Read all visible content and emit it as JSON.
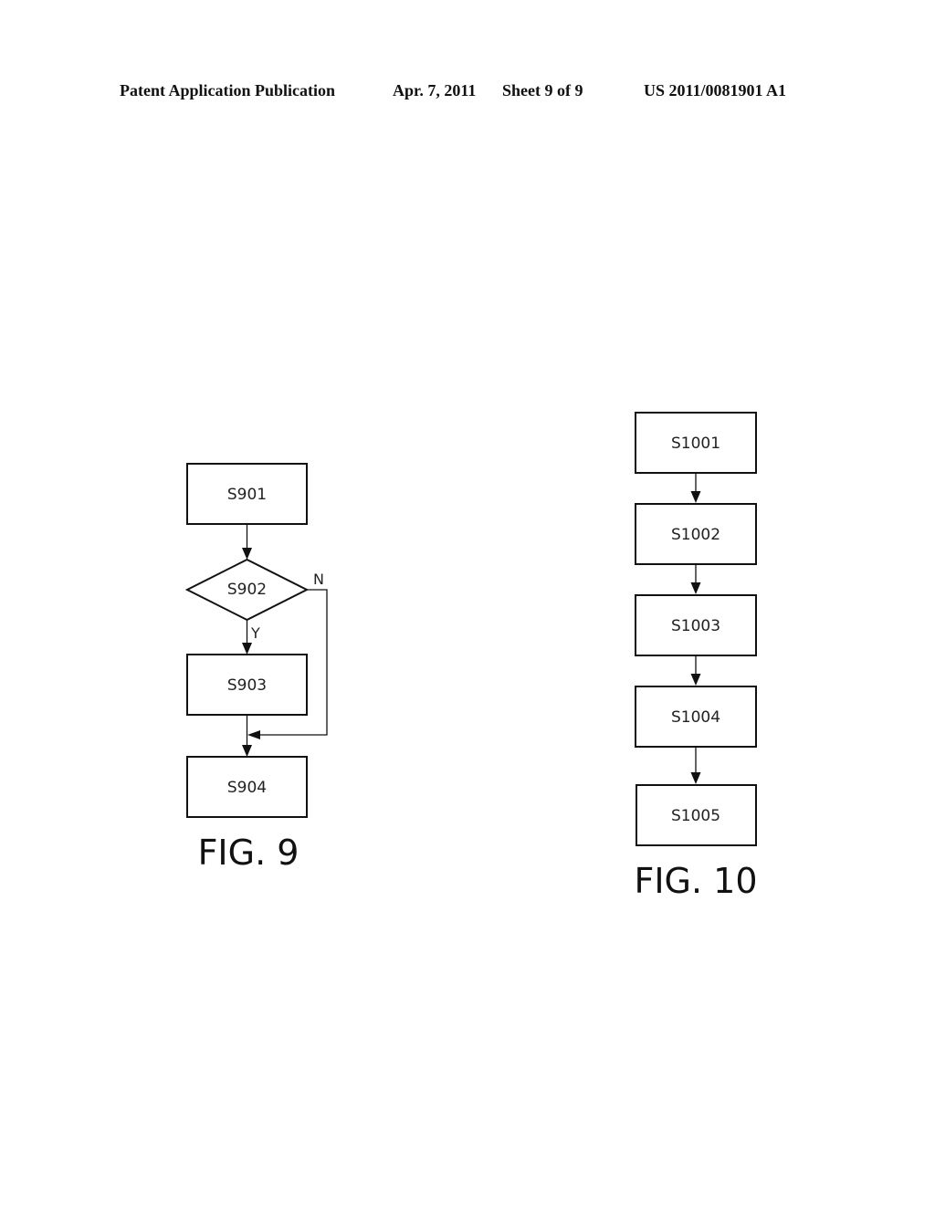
{
  "header": {
    "publication": "Patent Application Publication",
    "date": "Apr. 7, 2011",
    "sheet": "Sheet 9 of 9",
    "number": "US 2011/0081901 A1"
  },
  "fig9": {
    "caption": "FIG. 9",
    "steps": [
      "S901",
      "S902",
      "S903",
      "S904"
    ],
    "decision": {
      "step": "S902",
      "yes_label": "Y",
      "no_label": "N"
    }
  },
  "fig10": {
    "caption": "FIG. 10",
    "steps": [
      "S1001",
      "S1002",
      "S1003",
      "S1004",
      "S1005"
    ]
  }
}
